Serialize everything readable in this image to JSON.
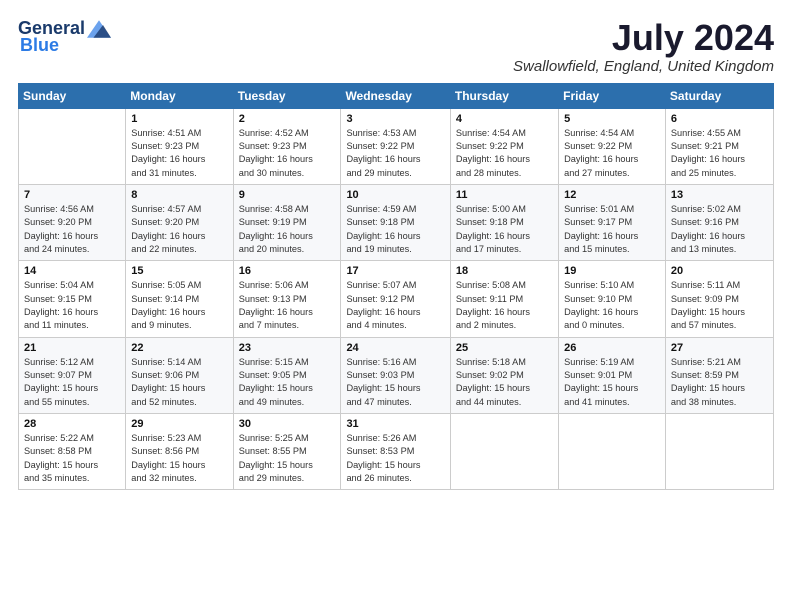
{
  "header": {
    "logo_general": "General",
    "logo_blue": "Blue",
    "month_year": "July 2024",
    "location": "Swallowfield, England, United Kingdom"
  },
  "days_of_week": [
    "Sunday",
    "Monday",
    "Tuesday",
    "Wednesday",
    "Thursday",
    "Friday",
    "Saturday"
  ],
  "weeks": [
    [
      {
        "day": "",
        "detail": ""
      },
      {
        "day": "1",
        "detail": "Sunrise: 4:51 AM\nSunset: 9:23 PM\nDaylight: 16 hours\nand 31 minutes."
      },
      {
        "day": "2",
        "detail": "Sunrise: 4:52 AM\nSunset: 9:23 PM\nDaylight: 16 hours\nand 30 minutes."
      },
      {
        "day": "3",
        "detail": "Sunrise: 4:53 AM\nSunset: 9:22 PM\nDaylight: 16 hours\nand 29 minutes."
      },
      {
        "day": "4",
        "detail": "Sunrise: 4:54 AM\nSunset: 9:22 PM\nDaylight: 16 hours\nand 28 minutes."
      },
      {
        "day": "5",
        "detail": "Sunrise: 4:54 AM\nSunset: 9:22 PM\nDaylight: 16 hours\nand 27 minutes."
      },
      {
        "day": "6",
        "detail": "Sunrise: 4:55 AM\nSunset: 9:21 PM\nDaylight: 16 hours\nand 25 minutes."
      }
    ],
    [
      {
        "day": "7",
        "detail": "Sunrise: 4:56 AM\nSunset: 9:20 PM\nDaylight: 16 hours\nand 24 minutes."
      },
      {
        "day": "8",
        "detail": "Sunrise: 4:57 AM\nSunset: 9:20 PM\nDaylight: 16 hours\nand 22 minutes."
      },
      {
        "day": "9",
        "detail": "Sunrise: 4:58 AM\nSunset: 9:19 PM\nDaylight: 16 hours\nand 20 minutes."
      },
      {
        "day": "10",
        "detail": "Sunrise: 4:59 AM\nSunset: 9:18 PM\nDaylight: 16 hours\nand 19 minutes."
      },
      {
        "day": "11",
        "detail": "Sunrise: 5:00 AM\nSunset: 9:18 PM\nDaylight: 16 hours\nand 17 minutes."
      },
      {
        "day": "12",
        "detail": "Sunrise: 5:01 AM\nSunset: 9:17 PM\nDaylight: 16 hours\nand 15 minutes."
      },
      {
        "day": "13",
        "detail": "Sunrise: 5:02 AM\nSunset: 9:16 PM\nDaylight: 16 hours\nand 13 minutes."
      }
    ],
    [
      {
        "day": "14",
        "detail": "Sunrise: 5:04 AM\nSunset: 9:15 PM\nDaylight: 16 hours\nand 11 minutes."
      },
      {
        "day": "15",
        "detail": "Sunrise: 5:05 AM\nSunset: 9:14 PM\nDaylight: 16 hours\nand 9 minutes."
      },
      {
        "day": "16",
        "detail": "Sunrise: 5:06 AM\nSunset: 9:13 PM\nDaylight: 16 hours\nand 7 minutes."
      },
      {
        "day": "17",
        "detail": "Sunrise: 5:07 AM\nSunset: 9:12 PM\nDaylight: 16 hours\nand 4 minutes."
      },
      {
        "day": "18",
        "detail": "Sunrise: 5:08 AM\nSunset: 9:11 PM\nDaylight: 16 hours\nand 2 minutes."
      },
      {
        "day": "19",
        "detail": "Sunrise: 5:10 AM\nSunset: 9:10 PM\nDaylight: 16 hours\nand 0 minutes."
      },
      {
        "day": "20",
        "detail": "Sunrise: 5:11 AM\nSunset: 9:09 PM\nDaylight: 15 hours\nand 57 minutes."
      }
    ],
    [
      {
        "day": "21",
        "detail": "Sunrise: 5:12 AM\nSunset: 9:07 PM\nDaylight: 15 hours\nand 55 minutes."
      },
      {
        "day": "22",
        "detail": "Sunrise: 5:14 AM\nSunset: 9:06 PM\nDaylight: 15 hours\nand 52 minutes."
      },
      {
        "day": "23",
        "detail": "Sunrise: 5:15 AM\nSunset: 9:05 PM\nDaylight: 15 hours\nand 49 minutes."
      },
      {
        "day": "24",
        "detail": "Sunrise: 5:16 AM\nSunset: 9:03 PM\nDaylight: 15 hours\nand 47 minutes."
      },
      {
        "day": "25",
        "detail": "Sunrise: 5:18 AM\nSunset: 9:02 PM\nDaylight: 15 hours\nand 44 minutes."
      },
      {
        "day": "26",
        "detail": "Sunrise: 5:19 AM\nSunset: 9:01 PM\nDaylight: 15 hours\nand 41 minutes."
      },
      {
        "day": "27",
        "detail": "Sunrise: 5:21 AM\nSunset: 8:59 PM\nDaylight: 15 hours\nand 38 minutes."
      }
    ],
    [
      {
        "day": "28",
        "detail": "Sunrise: 5:22 AM\nSunset: 8:58 PM\nDaylight: 15 hours\nand 35 minutes."
      },
      {
        "day": "29",
        "detail": "Sunrise: 5:23 AM\nSunset: 8:56 PM\nDaylight: 15 hours\nand 32 minutes."
      },
      {
        "day": "30",
        "detail": "Sunrise: 5:25 AM\nSunset: 8:55 PM\nDaylight: 15 hours\nand 29 minutes."
      },
      {
        "day": "31",
        "detail": "Sunrise: 5:26 AM\nSunset: 8:53 PM\nDaylight: 15 hours\nand 26 minutes."
      },
      {
        "day": "",
        "detail": ""
      },
      {
        "day": "",
        "detail": ""
      },
      {
        "day": "",
        "detail": ""
      }
    ]
  ]
}
